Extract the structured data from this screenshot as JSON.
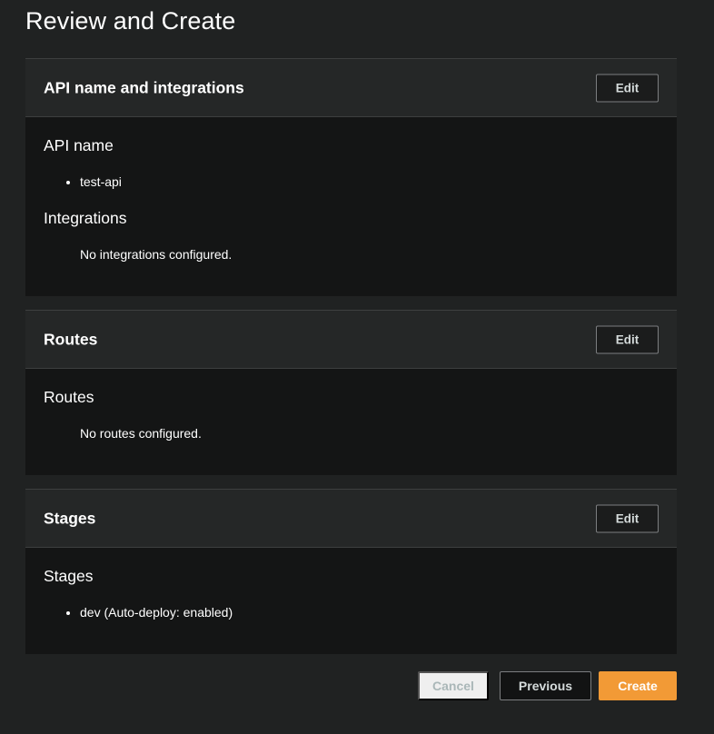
{
  "page": {
    "title": "Review and Create"
  },
  "sections": {
    "api": {
      "heading": "API name and integrations",
      "edit_label": "Edit",
      "api_name_heading": "API name",
      "api_names": [
        "test-api"
      ],
      "integrations_heading": "Integrations",
      "integrations_empty": "No integrations configured."
    },
    "routes": {
      "heading": "Routes",
      "edit_label": "Edit",
      "routes_heading": "Routes",
      "routes_empty": "No routes configured."
    },
    "stages": {
      "heading": "Stages",
      "edit_label": "Edit",
      "stages_heading": "Stages",
      "stages_list": [
        "dev (Auto-deploy: enabled)"
      ]
    }
  },
  "footer": {
    "cancel_label": "Cancel",
    "previous_label": "Previous",
    "create_label": "Create"
  },
  "colors": {
    "background": "#202222",
    "panel_body": "#141515",
    "panel_header": "#252727",
    "primary_button": "#f29a36"
  }
}
